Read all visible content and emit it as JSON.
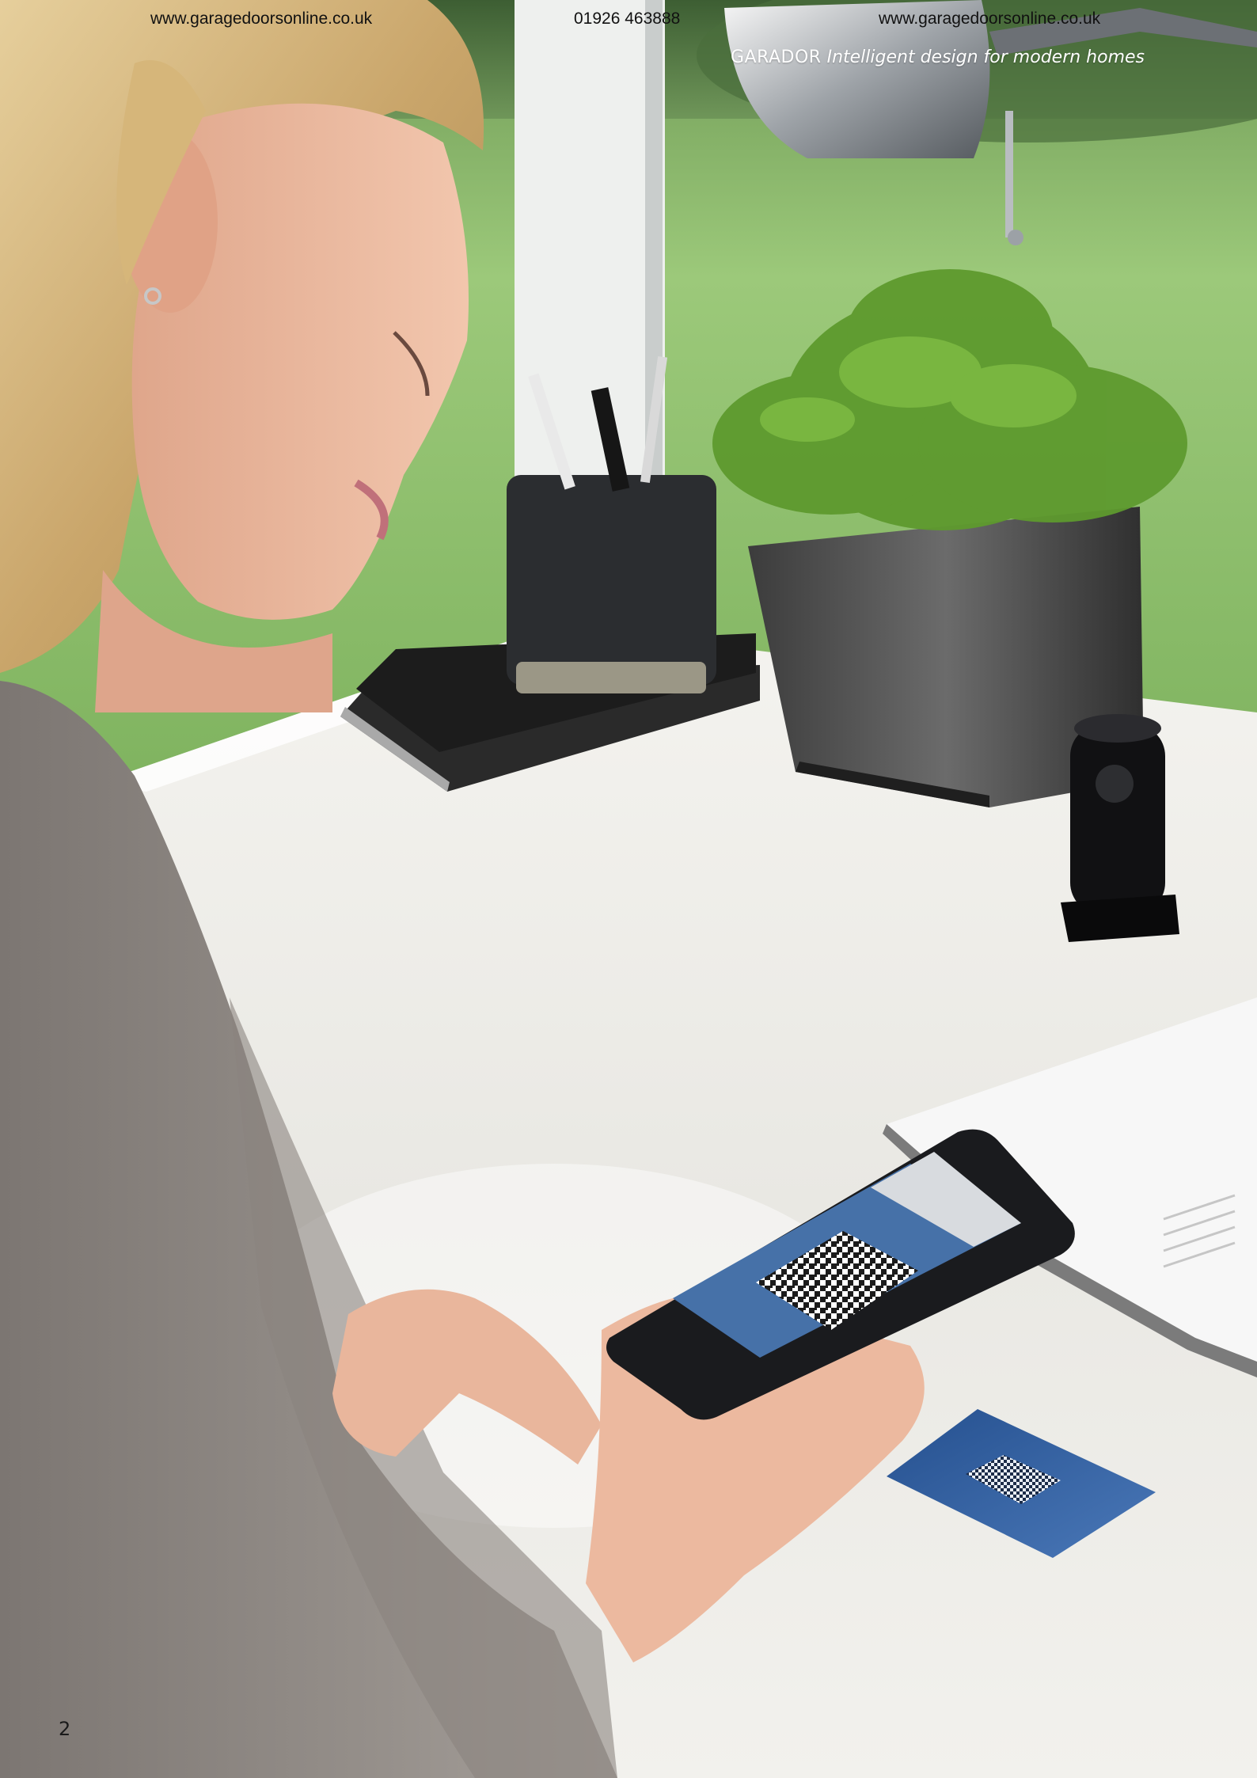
{
  "header": {
    "website_left": "www.garagedoorsonline.co.uk",
    "phone": "01926 463888",
    "website_right": "www.garagedoorsonline.co.uk",
    "brand": "GARADOR",
    "slogan": "Intelligent design for modern homes"
  },
  "footer": {
    "page_number": "2"
  },
  "icons": [
    "woman-using-smartphone-photo",
    "desk-lamp-icon",
    "pen-holder-icon",
    "potted-plant-icon",
    "qr-code-icon",
    "wireless-receiver-icon",
    "qr-code-card-icon"
  ],
  "colors": {
    "lawn": "#86b868",
    "desk": "#ecebe7",
    "sweater": "#8f8984",
    "card_blue": "#2f5d9e"
  }
}
